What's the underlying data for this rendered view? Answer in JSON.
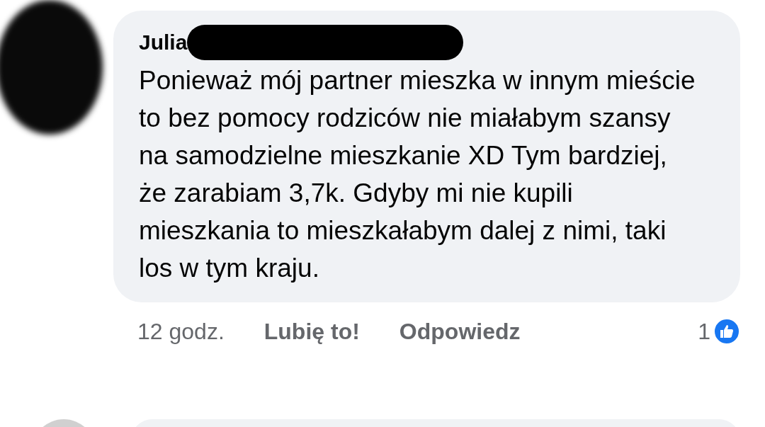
{
  "comment": {
    "author": "Julia",
    "text": "Ponieważ mój partner mieszka w innym mieście to bez pomocy rodziców nie miałabym szansy na samodzielne mieszkanie XD Tym bardziej, że zarabiam 3,7k. Gdyby mi nie kupili mieszkania to mieszkałabym dalej z nimi, taki los w tym kraju.",
    "time": "12 godz.",
    "actions": [
      "Lubię to!",
      "Odpowiedz"
    ],
    "reaction_count": "1"
  }
}
